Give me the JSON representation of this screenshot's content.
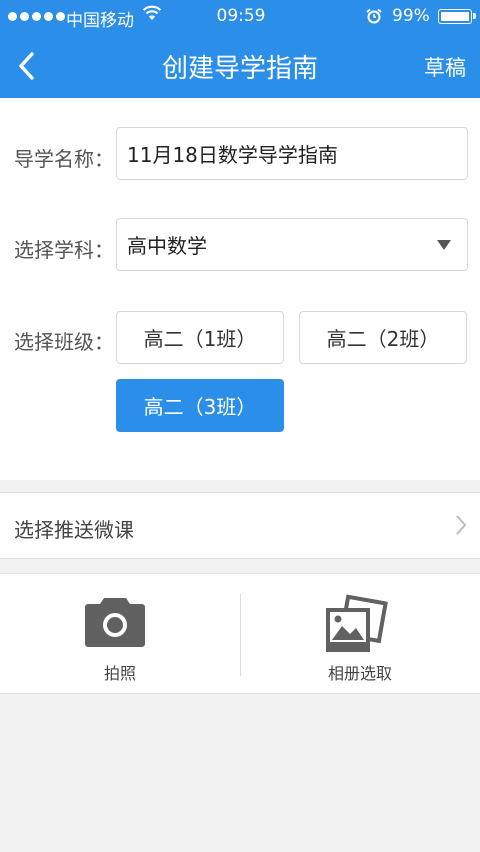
{
  "status_bar": {
    "carrier": "中国移动",
    "time": "09:59",
    "battery": "99%"
  },
  "header": {
    "title": "创建导学指南",
    "draft_label": "草稿",
    "color": "#2b8ee8"
  },
  "form": {
    "name_label": "导学名称：",
    "name_value": "11月18日数学导学指南",
    "subject_label": "选择学科：",
    "subject_value": "高中数学",
    "class_label": "选择班级：",
    "classes": [
      {
        "label": "高二（1班）",
        "selected": false
      },
      {
        "label": "高二（2班）",
        "selected": false
      },
      {
        "label": "高二（3班）",
        "selected": true
      }
    ]
  },
  "weike_row": {
    "label": "选择推送微课"
  },
  "actions": {
    "photo_label": "拍照",
    "album_label": "相册选取"
  }
}
